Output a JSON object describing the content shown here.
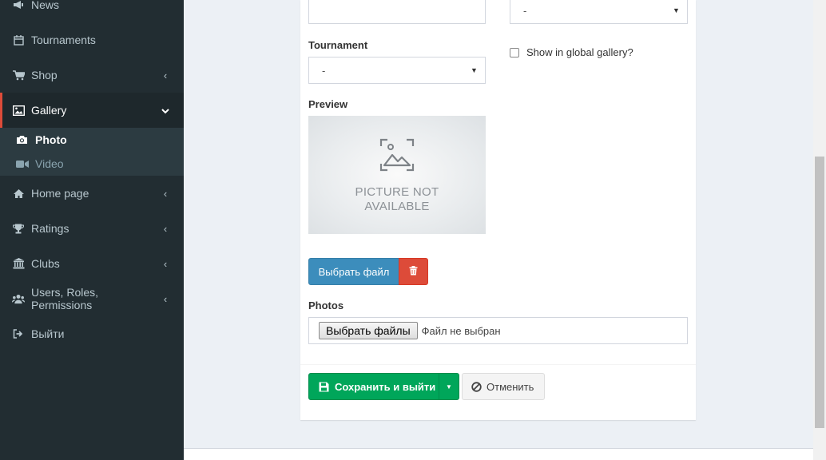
{
  "sidebar": {
    "items": [
      {
        "label": "News",
        "icon": "bullhorn-icon"
      },
      {
        "label": "Tournaments",
        "icon": "calendar-icon"
      },
      {
        "label": "Shop",
        "icon": "shopping-cart-icon",
        "chevron": "‹"
      },
      {
        "label": "Gallery",
        "icon": "picture-icon",
        "chevron": "⌄",
        "active": true
      },
      {
        "label": "Home page",
        "icon": "home-icon",
        "chevron": "‹"
      },
      {
        "label": "Ratings",
        "icon": "trophy-icon",
        "chevron": "‹"
      },
      {
        "label": "Clubs",
        "icon": "institution-icon",
        "chevron": "‹"
      },
      {
        "label": "Users, Roles, Permissions",
        "icon": "users-icon",
        "chevron": "‹"
      },
      {
        "label": "Выйти",
        "icon": "sign-out-icon"
      }
    ],
    "submenu": [
      {
        "label": "Photo",
        "icon": "camera-icon",
        "active": true
      },
      {
        "label": "Video",
        "icon": "video-camera-icon"
      }
    ]
  },
  "form": {
    "top_select_value": "-",
    "tournament_label": "Tournament",
    "tournament_value": "-",
    "global_gallery_label": "Show in global gallery?",
    "global_gallery_checked": false,
    "preview_label": "Preview",
    "preview_placeholder_line1": "PICTURE NOT",
    "preview_placeholder_line2": "AVAILABLE",
    "choose_file_label": "Выбрать файл",
    "photos_label": "Photos",
    "choose_files_label": "Выбрать файлы",
    "no_file_text": "Файл не выбран"
  },
  "actions": {
    "save_label": "Сохранить и выйти",
    "cancel_label": "Отменить"
  },
  "colors": {
    "sidebar_bg": "#222d32",
    "active_border": "#dd4b39",
    "primary": "#3c8dbc",
    "danger": "#dd4b39",
    "success": "#00a65a"
  }
}
